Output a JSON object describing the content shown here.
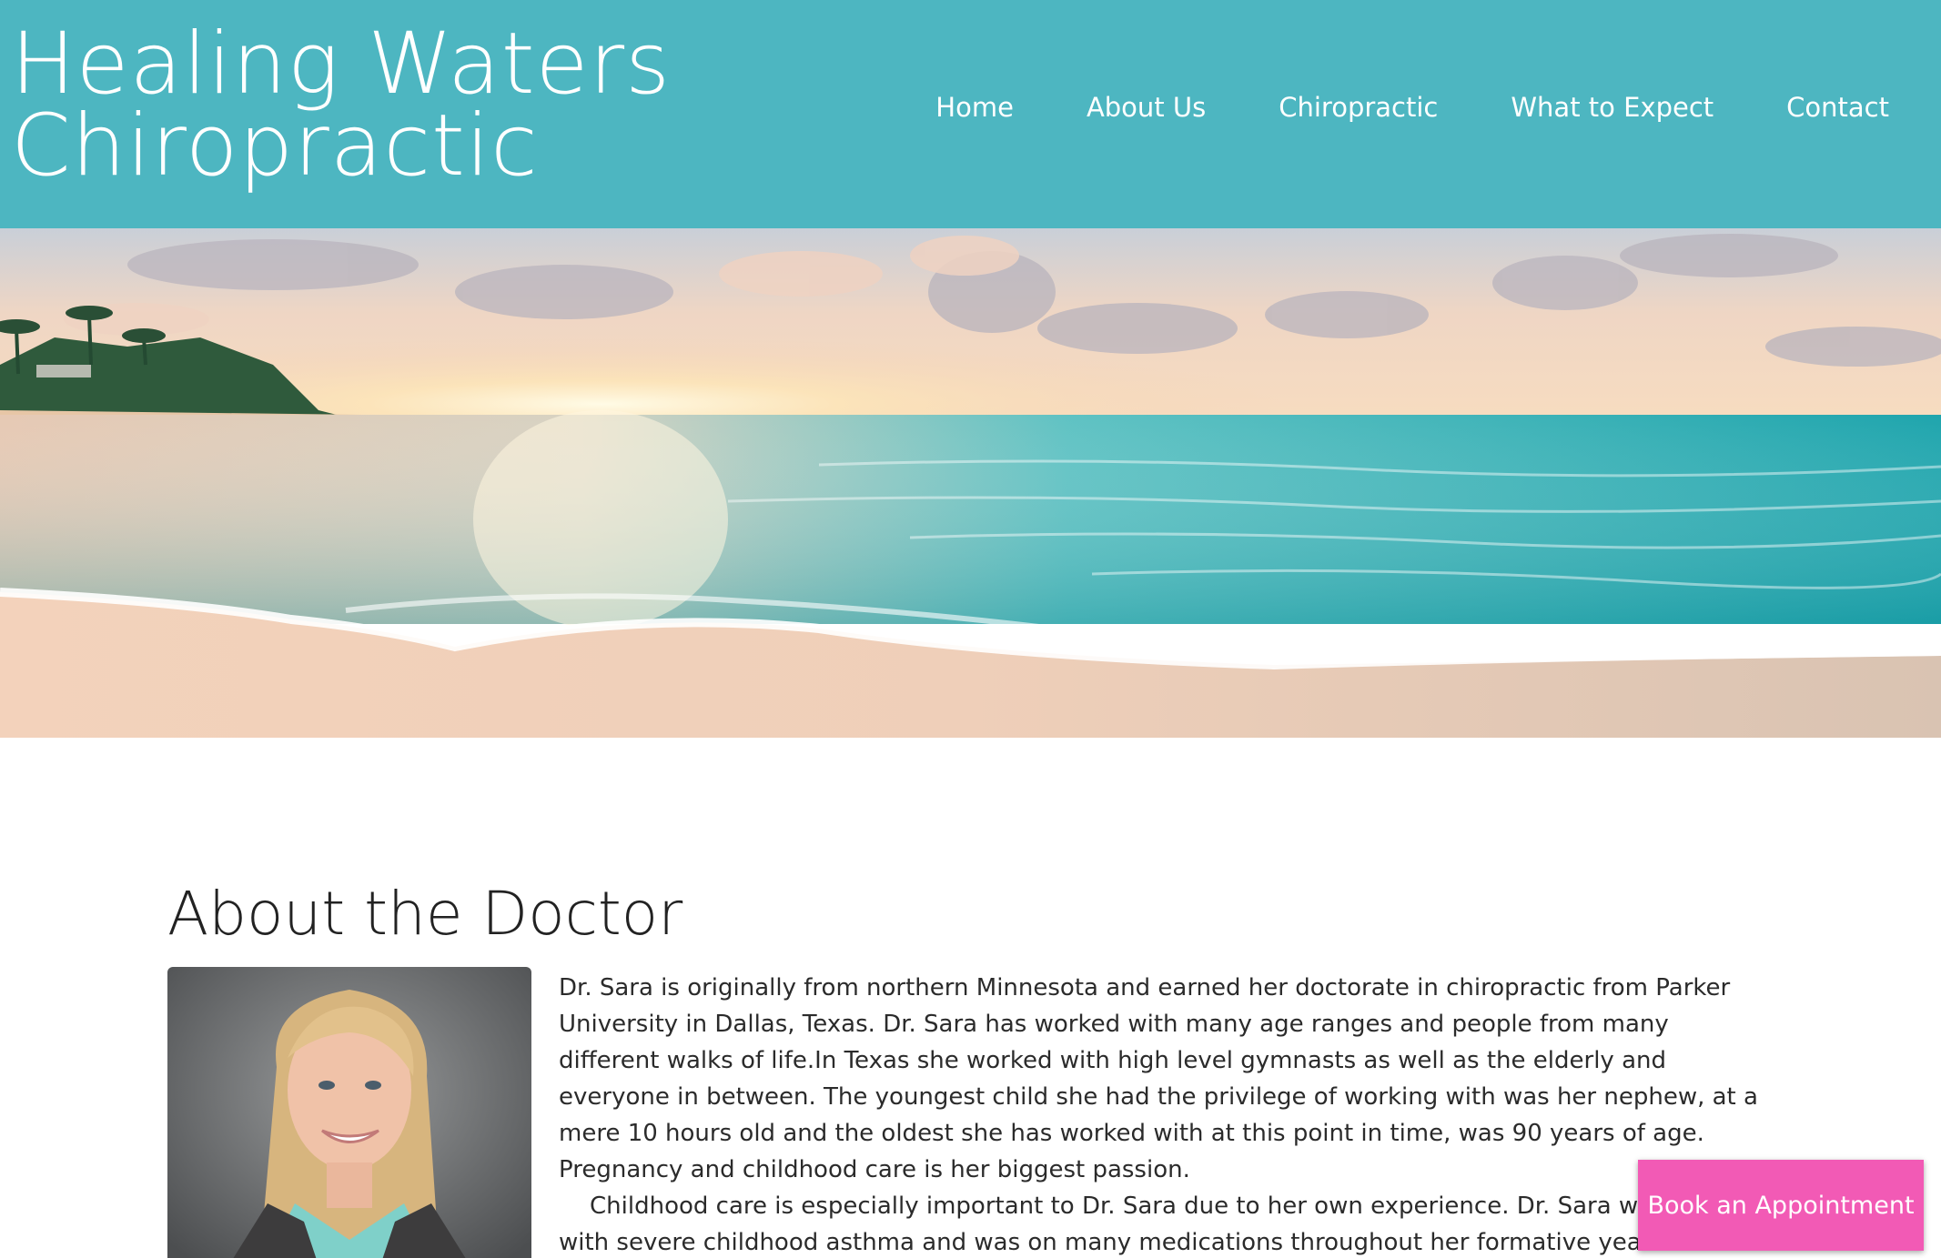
{
  "brand": {
    "line1": "Healing Waters",
    "line2": "Chiropractic"
  },
  "nav": {
    "items": [
      {
        "label": "Home"
      },
      {
        "label": "About Us"
      },
      {
        "label": "Chiropractic"
      },
      {
        "label": "What to Expect"
      },
      {
        "label": "Contact"
      }
    ]
  },
  "about": {
    "title": "About the Doctor",
    "paragraph1": "Dr. Sara is originally from northern Minnesota and earned her doctorate in chiropractic from Parker University in Dallas, Texas. Dr. Sara has worked with many age ranges and people from many different walks of life.In Texas she worked with high level gymnasts as well as the elderly and everyone in between. The youngest child she had the privilege of working with was her nephew, at a mere 10 hours old and the oldest she has worked with at this point in time, was 90 years of age. Pregnancy and childhood care is her biggest passion.",
    "paragraph2_line1": "Childhood care is especially important to Dr. Sara due to her own experience. Dr. Sara was di",
    "paragraph2_line2": "with severe childhood asthma and was on many medications throughout her formative years. W"
  },
  "cta": {
    "book_label": "Book an Appointment"
  },
  "colors": {
    "header_bg": "#4db6c1",
    "cta_bg": "#f25ab5",
    "text": "#2b2b2b"
  }
}
